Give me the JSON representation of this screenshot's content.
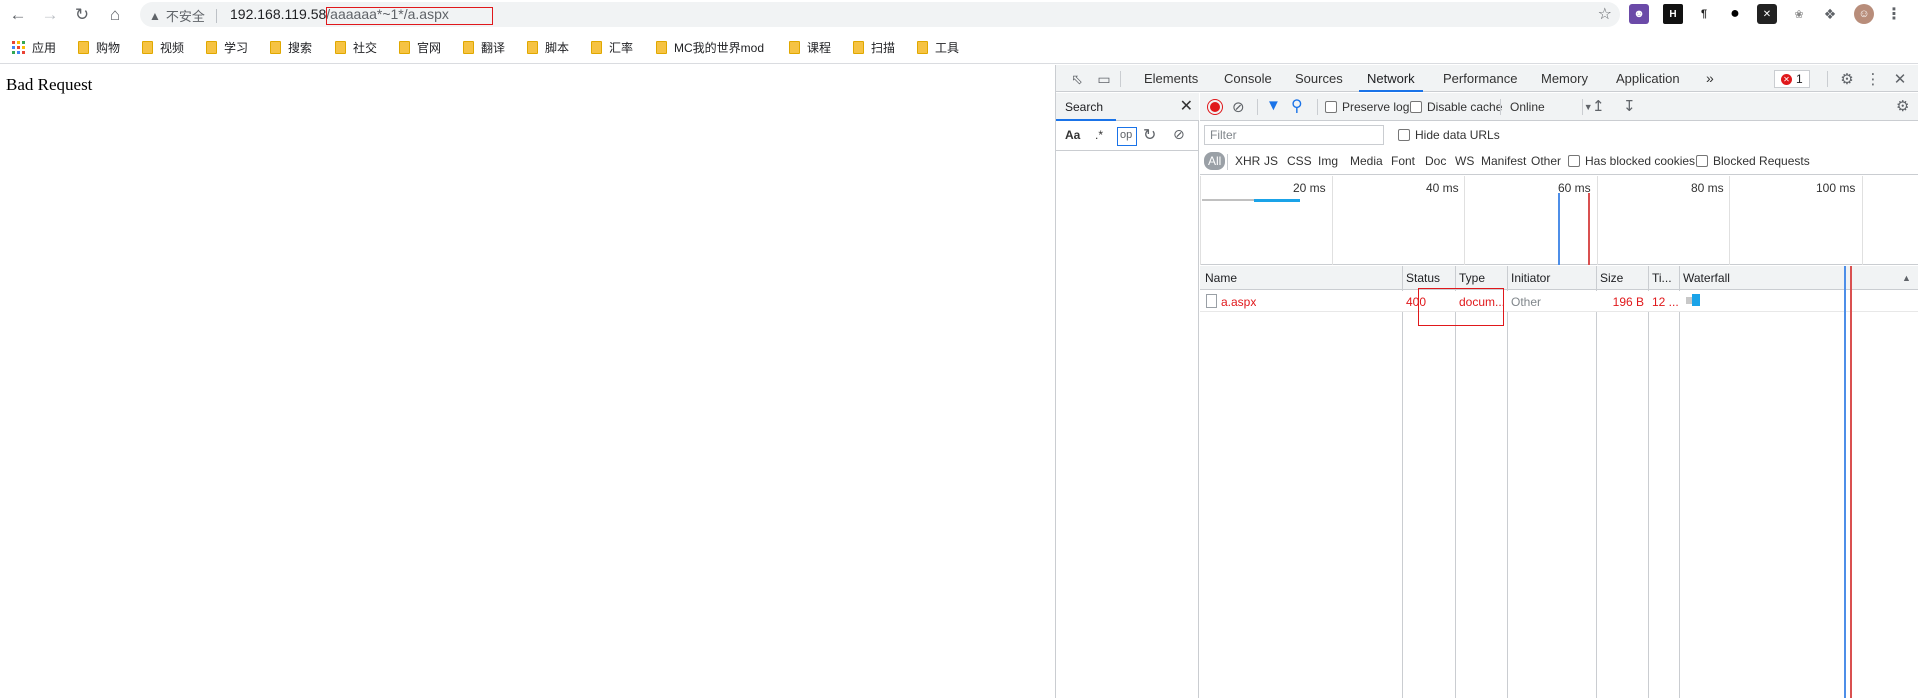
{
  "browser": {
    "security_label": "不安全",
    "url_host": "192.168.119.58",
    "url_path": "/aaaaaa*~1*/a.aspx",
    "icons": {
      "back": "arrow-left",
      "forward": "arrow-right",
      "reload": "refresh",
      "home": "house",
      "warning": "warning-triangle",
      "bookmark": "star",
      "extensions": "puzzle-piece"
    }
  },
  "bookmarks": {
    "apps_label": "应用",
    "items": [
      "购物",
      "视频",
      "学习",
      "搜索",
      "社交",
      "官网",
      "翻译",
      "脚本",
      "汇率",
      "MC我的世界mod",
      "课程",
      "扫描",
      "工具"
    ]
  },
  "page": {
    "text": "Bad Request"
  },
  "devtools": {
    "tabs": [
      "Elements",
      "Console",
      "Sources",
      "Network",
      "Performance",
      "Memory",
      "Application"
    ],
    "active_tab": "Network",
    "more_tabs": "»",
    "error_count": "1",
    "search_panel": {
      "title": "Search",
      "match_case": "Aa",
      "regex": ".*",
      "input_value": "op"
    },
    "toolbar": {
      "preserve_log": "Preserve log",
      "disable_cache": "Disable cache",
      "throttle": "Online"
    },
    "filter": {
      "placeholder": "Filter",
      "hide_data_urls": "Hide data URLs"
    },
    "types": [
      "All",
      "XHR",
      "JS",
      "CSS",
      "Img",
      "Media",
      "Font",
      "Doc",
      "WS",
      "Manifest",
      "Other"
    ],
    "has_blocked_cookies": "Has blocked cookies",
    "blocked_requests": "Blocked Requests",
    "timeline_labels": [
      "20 ms",
      "40 ms",
      "60 ms",
      "80 ms",
      "100 ms"
    ],
    "columns": {
      "name": "Name",
      "status": "Status",
      "type": "Type",
      "initiator": "Initiator",
      "size": "Size",
      "time": "Ti...",
      "waterfall": "Waterfall"
    },
    "rows": [
      {
        "name": "a.aspx",
        "status": "400",
        "type": "docum...",
        "initiator": "Other",
        "size": "196 B",
        "time": "12 ..."
      }
    ],
    "colors": {
      "error": "#e0181b",
      "accent": "#1a73e8"
    }
  }
}
